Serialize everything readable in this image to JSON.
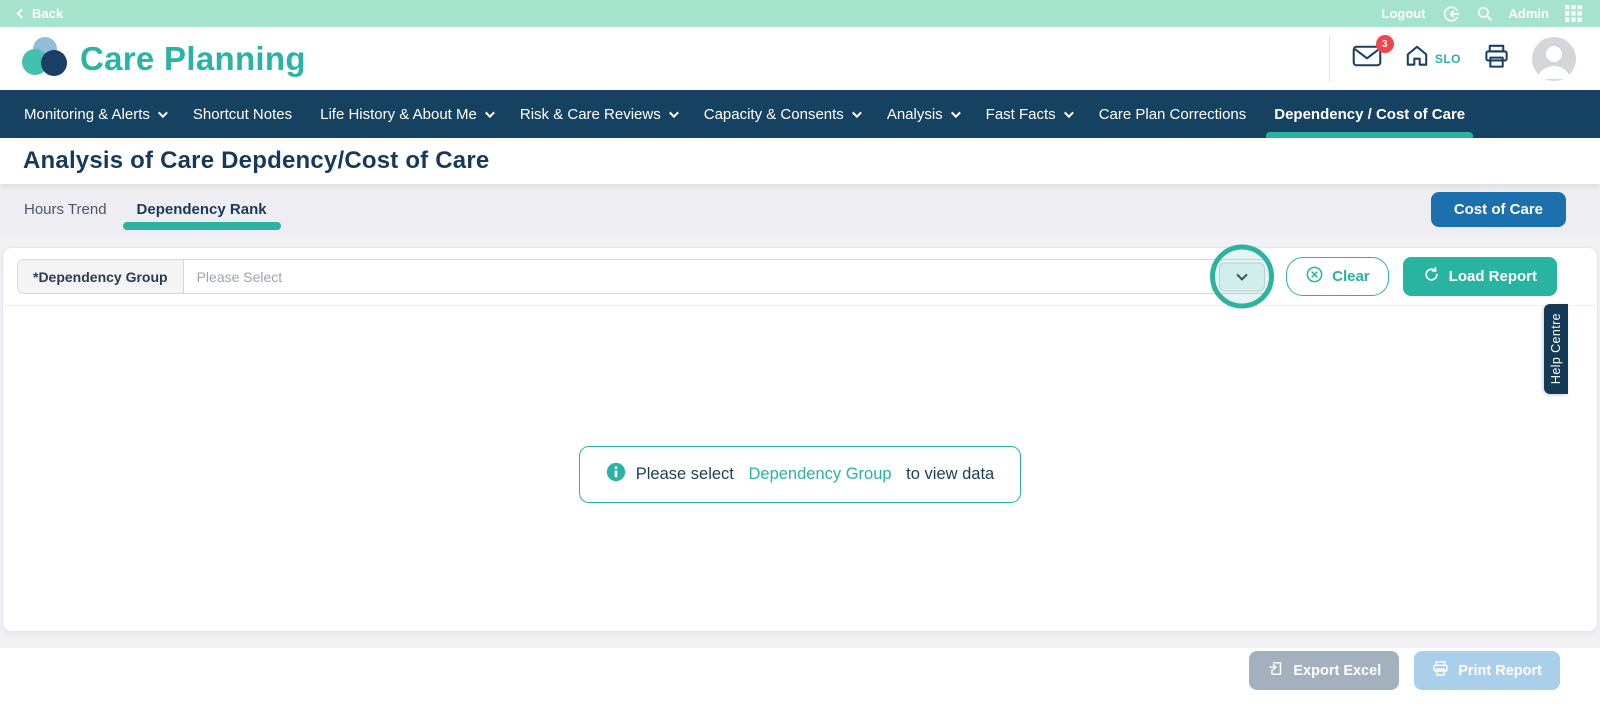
{
  "topbar": {
    "back_label": "Back",
    "logout_label": "Logout",
    "admin_label": "Admin"
  },
  "header": {
    "app_title": "Care Planning",
    "mail_badge": "3",
    "home_label": "SLO"
  },
  "nav": {
    "items": [
      {
        "label": "Monitoring & Alerts",
        "has_dropdown": true,
        "active": false
      },
      {
        "label": "Shortcut Notes",
        "has_dropdown": false,
        "active": false
      },
      {
        "label": "Life History & About Me",
        "has_dropdown": true,
        "active": false
      },
      {
        "label": "Risk & Care Reviews",
        "has_dropdown": true,
        "active": false
      },
      {
        "label": "Capacity & Consents",
        "has_dropdown": true,
        "active": false
      },
      {
        "label": "Analysis",
        "has_dropdown": true,
        "active": false
      },
      {
        "label": "Fast Facts",
        "has_dropdown": true,
        "active": false
      },
      {
        "label": "Care Plan Corrections",
        "has_dropdown": false,
        "active": false
      },
      {
        "label": "Dependency / Cost of Care",
        "has_dropdown": false,
        "active": true
      }
    ]
  },
  "page": {
    "title": "Analysis of Care Depdency/Cost of Care"
  },
  "tabs": {
    "items": [
      {
        "label": "Hours Trend",
        "active": false
      },
      {
        "label": "Dependency Rank",
        "active": true
      }
    ],
    "cost_of_care_label": "Cost of Care"
  },
  "filter": {
    "group_label": "*Dependency Group",
    "placeholder": "Please Select",
    "clear_label": "Clear",
    "load_report_label": "Load Report"
  },
  "message": {
    "prefix": "Please select ",
    "link": "Dependency Group",
    "suffix": " to view data"
  },
  "help_tab": {
    "label": "Help Centre"
  },
  "footer": {
    "export_label": "Export Excel",
    "print_label": "Print Report"
  },
  "colors": {
    "mint": "#A6E3CD",
    "teal_accent": "#2BB3A1",
    "navy": "#154260",
    "title_navy": "#173A5C",
    "blue_button": "#1C70AD",
    "badge_red": "#F0454F",
    "export_gray": "#A3B1BE",
    "print_blue": "#A9CFEA"
  }
}
